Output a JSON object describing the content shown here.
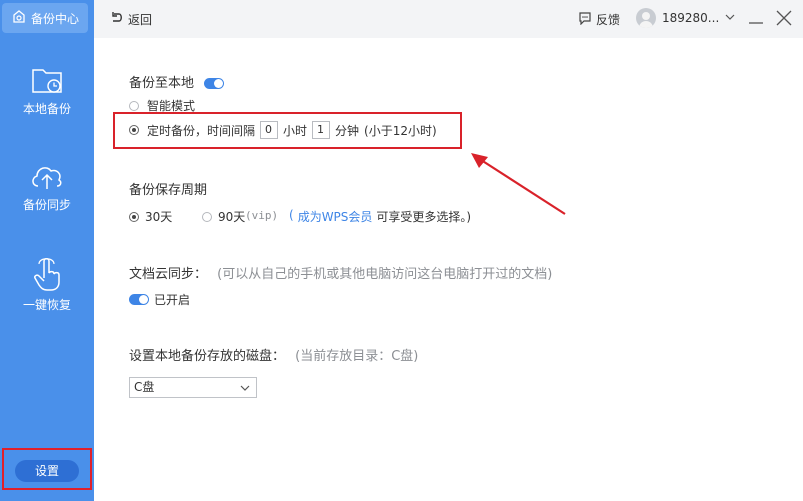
{
  "sidebar": {
    "brand_label": "备份中心",
    "items": [
      {
        "label": "本地备份",
        "icon": "local-backup-icon"
      },
      {
        "label": "备份同步",
        "icon": "cloud-upload-icon"
      },
      {
        "label": "一键恢复",
        "icon": "hand-tap-icon"
      }
    ],
    "settings_label": "设置"
  },
  "topbar": {
    "back_label": "返回",
    "feedback_label": "反馈",
    "username": "189280..."
  },
  "local_backup": {
    "title": "备份至本地",
    "toggle_on": true,
    "smart_mode_label": "智能模式",
    "timed_label": "定时备份，时间间隔",
    "hours_value": "0",
    "hours_unit": "小时",
    "minutes_value": "1",
    "minutes_unit": "分钟",
    "limit_note": "(小于12小时)"
  },
  "retention": {
    "title": "备份保存周期",
    "option_30": "30天",
    "option_90": "90天",
    "vip_tag": "(vip)",
    "paren_open": "(",
    "wps_link": "成为WPS会员",
    "more_text": "可享受更多选择。)"
  },
  "cloud_sync": {
    "title": "文档云同步：",
    "hint": "(可以从自己的手机或其他电脑访问这台电脑打开过的文档)",
    "status_label": "已开启"
  },
  "disk": {
    "title": "设置本地备份存放的磁盘：",
    "hint": "(当前存放目录：C盘)",
    "selected": "C盘"
  },
  "colors": {
    "sidebar_bg": "#4a90ea",
    "accent": "#3e85e6",
    "highlight_red": "#d9222a"
  }
}
